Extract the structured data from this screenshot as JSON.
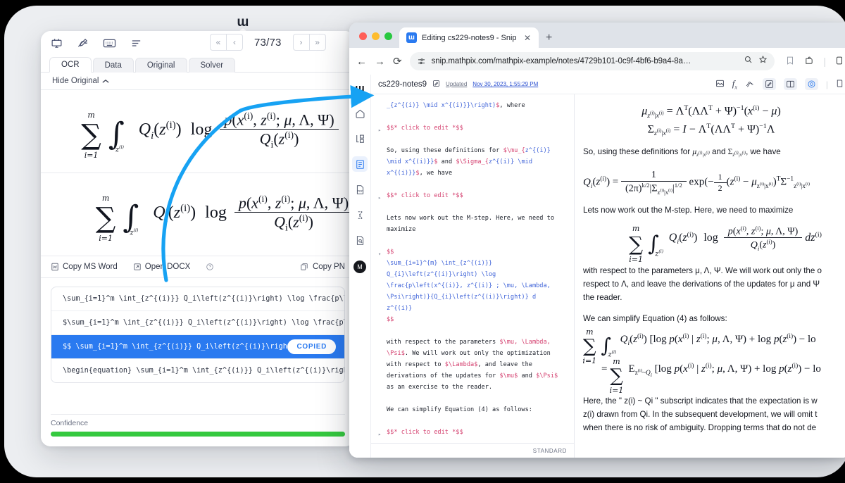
{
  "desktop": {
    "logo_glyph": "ɯ",
    "logo_name": "mathpix-logo"
  },
  "snip_app": {
    "toolbar_icons": [
      "snip-capture-icon",
      "draw-icon",
      "keyboard-icon",
      "list-icon"
    ],
    "pager": {
      "first_label": "«",
      "prev_label": "‹",
      "page_text": "73/73",
      "next_label": "›",
      "last_label": "»"
    },
    "tabs": [
      {
        "label": "OCR",
        "active": true
      },
      {
        "label": "Data",
        "active": false
      },
      {
        "label": "Original",
        "active": false
      },
      {
        "label": "Solver",
        "active": false
      }
    ],
    "hide_original_label": "Hide Original",
    "hide_original_chevron": "⌃",
    "copy_bar": {
      "copy_ms_word": "Copy MS Word",
      "open_docx": "Open DOCX",
      "help_glyph": "?",
      "copy_png": "Copy PN"
    },
    "results": [
      {
        "text": "\\sum_{i=1}^m \\int_{z^{(i)}} Q_i\\left(z^{(i)}\\right) \\log \\frac{p\\lef…",
        "selected": false,
        "badge": null
      },
      {
        "text": "$\\sum_{i=1}^m \\int_{z^{(i)}} Q_i\\left(z^{(i)}\\right) \\log \\frac{p\\le…",
        "selected": false,
        "badge": null
      },
      {
        "text": "$$ \\sum_{i=1}^m \\int_{z^{(i)}} Q_i\\left(z^{(i)}\\right) \\…",
        "selected": true,
        "badge": "COPIED"
      },
      {
        "text": "\\begin{equation} \\sum_{i=1}^m \\int_{z^{(i)}} Q_i\\left(z^{(i)}\\right)…",
        "selected": false,
        "badge": null
      }
    ],
    "confidence": {
      "label": "Confidence",
      "percent": 100,
      "color": "#35c93f"
    }
  },
  "browser": {
    "traffic_lights": [
      "close",
      "minimize",
      "zoom"
    ],
    "tab": {
      "favicon_glyph": "ɯ",
      "title": "Editing cs229-notes9 - Snip",
      "close_glyph": "✕"
    },
    "new_tab_glyph": "+",
    "nav": {
      "back_glyph": "←",
      "forward_glyph": "→",
      "reload_glyph": "⟳"
    },
    "omnibox": {
      "site_settings_icon": "tune-icon",
      "url": "snip.mathpix.com/mathpix-example/notes/4729b101-0c9f-4bf6-b9a4-8a…",
      "zoom_glyph": "⌕",
      "bookmark_glyph": "☆"
    },
    "toolbar_right": [
      "reading-list-icon",
      "extensions-icon",
      "menu-divider"
    ]
  },
  "snip_web": {
    "sidebar": [
      {
        "name": "app-logo",
        "glyph": "ɯ",
        "selected": false
      },
      {
        "name": "home",
        "glyph": "home-icon",
        "selected": false
      },
      {
        "name": "organize",
        "glyph": "folders-icon",
        "selected": false
      },
      {
        "name": "notes",
        "glyph": "document-icon",
        "selected": true
      },
      {
        "name": "pdf",
        "glyph": "pdf-icon",
        "selected": false
      },
      {
        "name": "snips",
        "glyph": "sigma-icon",
        "selected": false
      },
      {
        "name": "search-docs",
        "glyph": "doc-search-icon",
        "selected": false
      }
    ],
    "avatar_initial": "M",
    "header": {
      "doc_title": "cs229-notes9",
      "edit_title_icon": "pencil-square-icon",
      "updated_label": "Updated",
      "updated_date": "Nov 30, 2023, 1:55:29 PM",
      "tools": [
        "image-icon",
        "formula-icon",
        "ink-icon",
        "edit-mode-icon",
        "split-view-icon",
        "preview-icon"
      ]
    },
    "editor_lines": [
      {
        "type": "code",
        "indent": false,
        "parts": [
          {
            "t": "_{z^{(i)} ",
            "c": "cmd"
          },
          {
            "t": "\\mid x^{(i)}}\\right)",
            "c": "cmd"
          },
          {
            "t": "$",
            "c": "mag"
          },
          {
            "t": ", where",
            "c": "plain"
          }
        ]
      },
      {
        "type": "blank"
      },
      {
        "type": "fold",
        "parts": [
          {
            "t": "$$* click to edit *$$",
            "c": "mag"
          }
        ]
      },
      {
        "type": "blank"
      },
      {
        "type": "text",
        "parts": [
          {
            "t": "So, using these definitions for ",
            "c": "plain"
          },
          {
            "t": "$\\mu_{z^{(i)} \\mid x^{(i)}}$",
            "c": "mag"
          },
          {
            "t": " and ",
            "c": "plain"
          },
          {
            "t": "$\\Sigma_{z^{(i)} \\mid x^{(i)}}$",
            "c": "mag"
          },
          {
            "t": ", we have",
            "c": "plain"
          }
        ]
      },
      {
        "type": "blank"
      },
      {
        "type": "fold",
        "parts": [
          {
            "t": "$$* click to edit *$$",
            "c": "mag"
          }
        ]
      },
      {
        "type": "blank"
      },
      {
        "type": "text",
        "parts": [
          {
            "t": "Lets now work out the M-step. Here, we need to maximize",
            "c": "plain"
          }
        ]
      },
      {
        "type": "blank"
      },
      {
        "type": "foldopen",
        "parts": [
          {
            "t": "$$",
            "c": "mag"
          }
        ]
      },
      {
        "type": "code",
        "parts": [
          {
            "t": "\\sum_{i=1}^{m} \\int_{z^{(i)}}",
            "c": "cmd"
          }
        ]
      },
      {
        "type": "code",
        "parts": [
          {
            "t": "Q_{i}\\left(z^{(i)}\\right) \\log",
            "c": "cmd"
          }
        ]
      },
      {
        "type": "code",
        "arrow": true,
        "parts": [
          {
            "t": "\\frac{p\\left(x^{(i)}, z^{(i)} ; \\mu, \\Lambda,",
            "c": "cmd"
          }
        ]
      },
      {
        "type": "code",
        "parts": [
          {
            "t": "\\Psi\\right)}{Q_{i}\\left(z^{(i)}\\right)} d",
            "c": "cmd"
          }
        ]
      },
      {
        "type": "code",
        "parts": [
          {
            "t": "z^{(i)}",
            "c": "cmd"
          }
        ]
      },
      {
        "type": "code",
        "parts": [
          {
            "t": "$$",
            "c": "mag"
          }
        ]
      },
      {
        "type": "blank"
      },
      {
        "type": "text",
        "parts": [
          {
            "t": "with respect to the parameters ",
            "c": "plain"
          },
          {
            "t": "$\\mu, \\Lambda, \\Psi$",
            "c": "mag"
          },
          {
            "t": ". We will work out only the optimization with respect to ",
            "c": "plain"
          },
          {
            "t": "$\\Lambda$",
            "c": "mag"
          },
          {
            "t": ", and leave the derivations of the updates for ",
            "c": "plain"
          },
          {
            "t": "$\\mu$",
            "c": "mag"
          },
          {
            "t": " and ",
            "c": "plain"
          },
          {
            "t": "$\\Psi$",
            "c": "mag"
          },
          {
            "t": " as an exercise to the reader.",
            "c": "plain"
          }
        ]
      },
      {
        "type": "blank"
      },
      {
        "type": "text",
        "parts": [
          {
            "t": "We can simplify Equation (4) as follows:",
            "c": "plain"
          }
        ]
      },
      {
        "type": "blank"
      },
      {
        "type": "fold",
        "parts": [
          {
            "t": "$$* click to edit *$$",
            "c": "mag"
          }
        ]
      }
    ],
    "editor_status": "STANDARD",
    "preview": {
      "paragraph_1": "So, using these definitions for μ and Σ, we have",
      "paragraph_2": "Lets now work out the M-step. Here, we need to maximize",
      "paragraph_3a": "with respect to the parameters μ, Λ, Ψ. We will work out only the o",
      "paragraph_3b": "respect to Λ, and leave the derivations of the updates for μ and Ψ ",
      "paragraph_3c": "the reader.",
      "paragraph_4": "We can simplify Equation (4) as follows:",
      "paragraph_5a": "Here, the \" z(i) ~ Qi \" subscript indicates that the expectation is w",
      "paragraph_5b": "z(i) drawn from Qi. In the subsequent development, we will omit t",
      "paragraph_5c": "when there is no risk of ambiguity. Dropping terms that do not de"
    }
  },
  "annotation": {
    "arrow_color": "#17a2f3",
    "arrow_name": "blue-curved-arrow"
  }
}
